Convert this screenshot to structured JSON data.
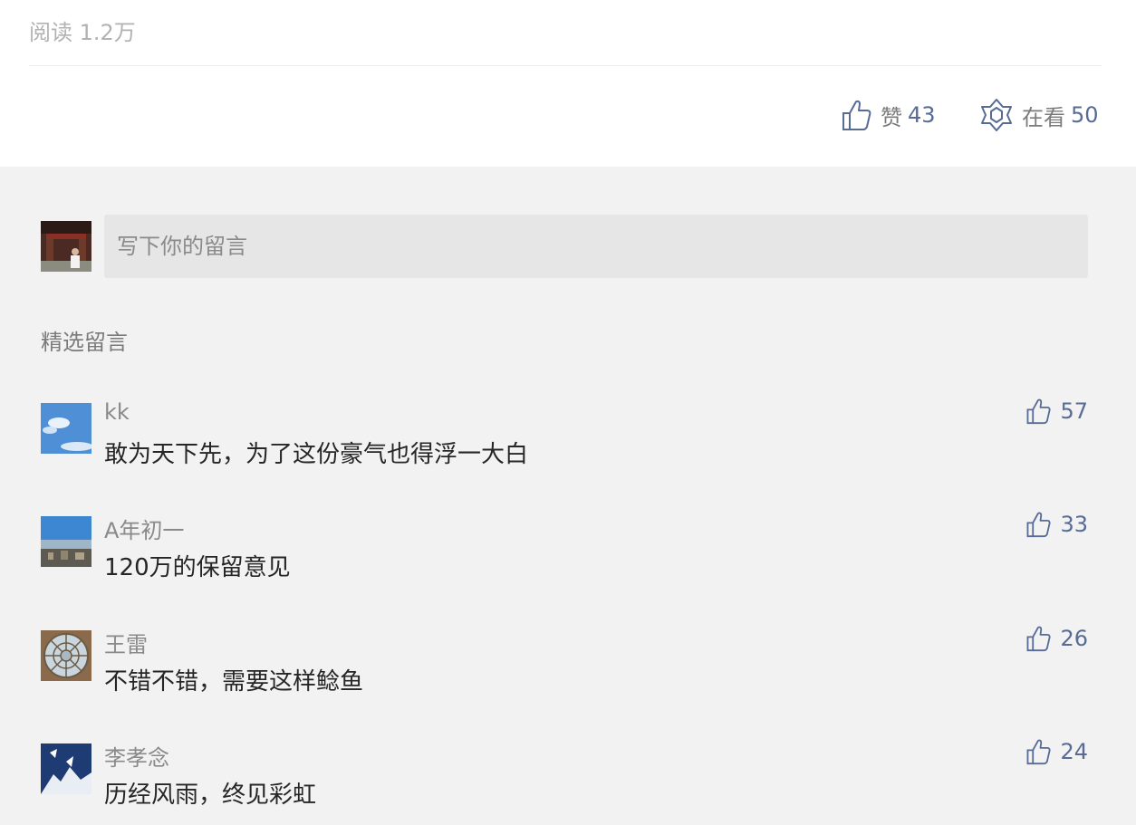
{
  "article": {
    "read_label": "阅读 1.2万"
  },
  "actions": {
    "like_label": "赞",
    "like_count": "43",
    "watch_label": "在看",
    "watch_count": "50"
  },
  "composer": {
    "placeholder": "写下你的留言"
  },
  "comments_section": {
    "title": "精选留言"
  },
  "comments": [
    {
      "name": "kk",
      "text": "敢为天下先，为了这份豪气也得浮一大白",
      "likes": "57"
    },
    {
      "name": "A年初一",
      "text": "120万的保留意见",
      "likes": "33"
    },
    {
      "name": "王雷",
      "text": "不错不错，需要这样鲶鱼",
      "likes": "26"
    },
    {
      "name": "李孝念",
      "text": "历经风雨，终见彩虹",
      "likes": "24"
    }
  ],
  "colors": {
    "link_blue": "#576b95",
    "page_bg": "#f2f2f2",
    "input_bg": "#e6e6e6",
    "muted_text": "#8a8a8a"
  },
  "icons": {
    "like": "thumbs-up-icon",
    "watch": "star-of-david-outline-icon"
  }
}
